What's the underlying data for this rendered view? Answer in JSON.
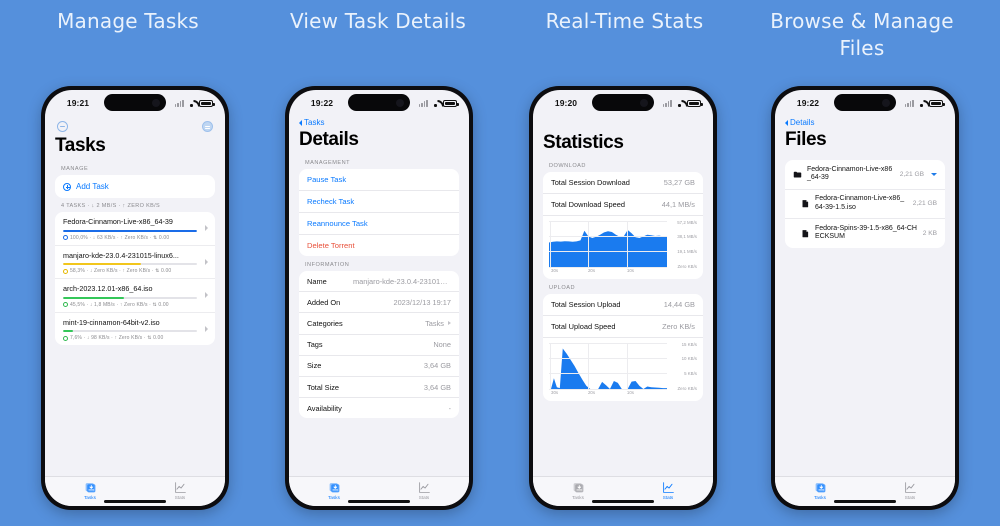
{
  "theme": {
    "background": "#5590DC",
    "accent_blue": "#0A7AFF",
    "chart_blue": "#1A7BEF",
    "danger_red": "#E8503A",
    "screen_bg": "#F2F2F7"
  },
  "captions": [
    {
      "text": "Manage Tasks"
    },
    {
      "text": "View Task Details"
    },
    {
      "text": "Real-Time Stats"
    },
    {
      "text": "Browse & Manage Files"
    }
  ],
  "phones": [
    {
      "id": "tasks",
      "status_bar": {
        "time": "19:21",
        "wifi": "wifi-icon",
        "battery": "battery-icon",
        "signal": "signal-icon"
      },
      "header_icons": {
        "left": "pause-all-icon",
        "right": "filter-icon"
      },
      "title": "Tasks",
      "section_manage_label": "MANAGE",
      "add_task_label": "Add Task",
      "summary": "4 TASKS · ↓ 2 MB/S · ↑ ZERO KB/S",
      "tasks": [
        {
          "name": "Fedora-Cinnamon-Live-x86_64-39",
          "progress": 100,
          "bar_color": "#1A6CE8",
          "status_color": "#1A6CE8",
          "meta": "100,0% · ↓ 63 KB/s · ↑ Zero KB/s · ⇅ 0.00"
        },
        {
          "name": "manjaro-kde-23.0.4-231015-linux6...",
          "progress": 58.3,
          "bar_color": "#F2C61C",
          "status_color": "#E5B800",
          "meta": "58,3% · ↓ Zero KB/s · ↑ Zero KB/s · ⇅ 0.00"
        },
        {
          "name": "arch-2023.12.01-x86_64.iso",
          "progress": 45.5,
          "bar_color": "#34C759",
          "status_color": "#2FB94F",
          "meta": "45,5% · ↓ 1,8 MB/s · ↑ Zero KB/s · ⇅ 0.00"
        },
        {
          "name": "mint-19-cinnamon-64bit-v2.iso",
          "progress": 7.6,
          "bar_color": "#34C759",
          "status_color": "#2FB94F",
          "meta": "7,6% · ↓ 98 KB/s · ↑ Zero KB/s · ⇅ 0.00"
        }
      ],
      "tabs": [
        {
          "label": "Tasks",
          "icon": "tasks-icon",
          "active": true
        },
        {
          "label": "Stats",
          "icon": "stats-icon",
          "active": false
        }
      ]
    },
    {
      "id": "details",
      "status_bar": {
        "time": "19:22"
      },
      "back_label": "Tasks",
      "title": "Details",
      "section_management_label": "MANAGEMENT",
      "actions": [
        {
          "label": "Pause Task",
          "kind": "normal"
        },
        {
          "label": "Recheck Task",
          "kind": "normal"
        },
        {
          "label": "Reannounce Task",
          "kind": "normal"
        },
        {
          "label": "Delete Torrent",
          "kind": "danger"
        }
      ],
      "section_information_label": "INFORMATION",
      "info": [
        {
          "key": "Name",
          "value": "manjaro-kde-23.0.4-231015-lin...",
          "chevron": false
        },
        {
          "key": "Added On",
          "value": "2023/12/13 19:17",
          "chevron": false
        },
        {
          "key": "Categories",
          "value": "Tasks",
          "chevron": true
        },
        {
          "key": "Tags",
          "value": "None",
          "chevron": false
        },
        {
          "key": "Size",
          "value": "3,64 GB",
          "chevron": false
        },
        {
          "key": "Total Size",
          "value": "3,64 GB",
          "chevron": false
        },
        {
          "key": "Availability",
          "value": "-",
          "chevron": false
        }
      ],
      "tabs": [
        {
          "label": "Tasks",
          "icon": "tasks-icon",
          "active": true
        },
        {
          "label": "Stats",
          "icon": "stats-icon",
          "active": false
        }
      ]
    },
    {
      "id": "statistics",
      "status_bar": {
        "time": "19:20"
      },
      "title": "Statistics",
      "section_download_label": "DOWNLOAD",
      "download_rows": [
        {
          "key": "Total Session Download",
          "value": "53,27 GB"
        },
        {
          "key": "Total Download Speed",
          "value": "44,1 MB/s"
        }
      ],
      "section_upload_label": "UPLOAD",
      "upload_rows": [
        {
          "key": "Total Session Upload",
          "value": "14,44 GB"
        },
        {
          "key": "Total Upload Speed",
          "value": "Zero KB/s"
        }
      ],
      "tabs": [
        {
          "label": "Tasks",
          "icon": "tasks-icon",
          "active": false
        },
        {
          "label": "Stats",
          "icon": "stats-icon",
          "active": true
        }
      ]
    },
    {
      "id": "files",
      "status_bar": {
        "time": "19:22"
      },
      "back_label": "Details",
      "title": "Files",
      "files": [
        {
          "name": "Fedora-Cinnamon-Live-x86_64-39",
          "size": "2,21 GB",
          "type": "folder",
          "expanded": true,
          "depth": 0
        },
        {
          "name": "Fedora-Cinnamon-Live-x86_64-39-1.5.iso",
          "size": "2,21 GB",
          "type": "file",
          "depth": 1
        },
        {
          "name": "Fedora-Spins-39-1.5-x86_64-CHECKSUM",
          "size": "2 KB",
          "type": "file",
          "depth": 1
        }
      ],
      "tabs": [
        {
          "label": "Tasks",
          "icon": "tasks-icon",
          "active": true
        },
        {
          "label": "Stats",
          "icon": "stats-icon",
          "active": false
        }
      ]
    }
  ],
  "chart_data": [
    {
      "type": "area",
      "title": "Download Speed",
      "xlabel": "",
      "ylabel": "MB/s",
      "x_ticks": [
        "30s",
        "20s",
        "10s"
      ],
      "y_ticks": [
        "Zero KB/s",
        "19,1 MB/s",
        "38,1 MB/s",
        "57,2 MB/s"
      ],
      "ylim": [
        0,
        57.2
      ],
      "color": "#1A7BEF",
      "values": [
        30.5,
        31.5,
        32,
        31.8,
        32.2,
        32,
        31.5,
        32,
        33,
        45,
        38,
        36,
        37.5,
        40,
        43,
        44.5,
        43.5,
        40,
        37.5,
        38,
        46,
        42,
        37,
        36,
        38,
        40,
        39.5,
        38.5,
        39,
        38
      ]
    },
    {
      "type": "area",
      "title": "Upload Speed",
      "xlabel": "",
      "ylabel": "KB/s",
      "x_ticks": [
        "30s",
        "20s",
        "10s"
      ],
      "y_ticks": [
        "Zero KB/s",
        "5 KB/s",
        "10 KB/s",
        "15 KB/s"
      ],
      "ylim": [
        0,
        15
      ],
      "color": "#1A7BEF",
      "values": [
        0,
        3.5,
        0.6,
        0.3,
        13.2,
        11.5,
        9.5,
        7.5,
        5.2,
        3.0,
        1.0,
        0,
        0,
        0,
        2.3,
        1.2,
        0,
        2.6,
        2.0,
        0,
        0,
        2.4,
        2.6,
        1.0,
        0,
        0.8,
        0.6,
        0.5,
        0.4,
        0.3
      ]
    }
  ]
}
